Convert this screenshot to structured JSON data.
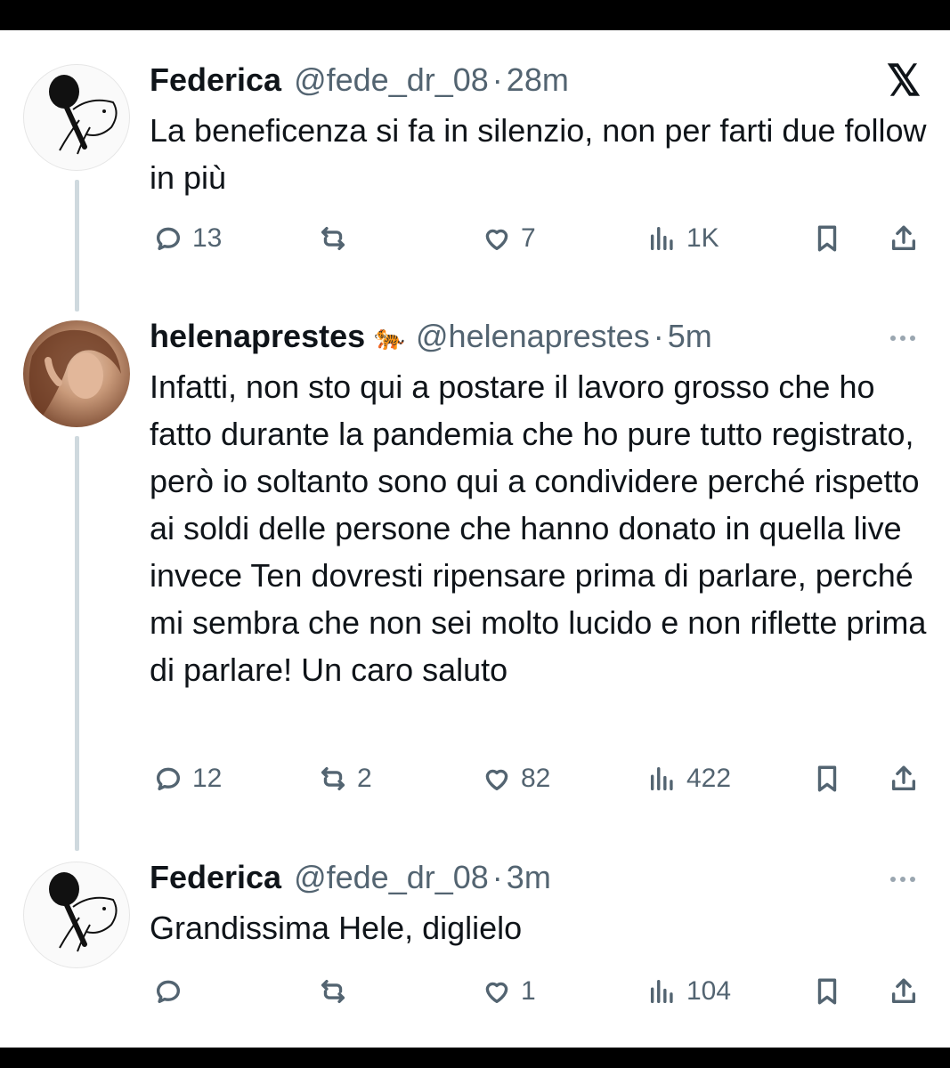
{
  "x_logo": "𝕏",
  "icons": {
    "reply": "reply-icon",
    "repost": "repost-icon",
    "like": "heart-icon",
    "views": "views-icon",
    "bookmark": "bookmark-icon",
    "share": "share-icon",
    "more": "more-icon",
    "logo": "x-logo-icon"
  },
  "colors": {
    "text": "#0f1419",
    "secondary": "#536471",
    "thread_line": "#cfd9de"
  },
  "tweets": [
    {
      "name": "Federica",
      "badge": "",
      "handle": "@fede_dr_08",
      "dot": "·",
      "time": "28m",
      "text": "La beneficenza si fa in silenzio, non per farti due follow in più",
      "replies": "13",
      "reposts": "",
      "likes": "7",
      "views": "1K"
    },
    {
      "name": "helenaprestes",
      "badge": "🐅",
      "handle": "@helenaprestes",
      "dot": "·",
      "time": "5m",
      "text": "Infatti, non sto qui a postare il lavoro grosso che ho fatto durante la pandemia che ho pure tutto registrato, però io soltanto sono qui a condividere perché rispetto ai soldi delle persone che hanno donato in quella live invece Ten dovresti ripensare prima di parlare, perché mi sembra che non sei molto lucido e non riflette prima di parlare! Un caro saluto",
      "replies": "12",
      "reposts": "2",
      "likes": "82",
      "views": "422"
    },
    {
      "name": "Federica",
      "badge": "",
      "handle": "@fede_dr_08",
      "dot": "·",
      "time": "3m",
      "text": "Grandissima Hele, diglielo",
      "replies": "",
      "reposts": "",
      "likes": "1",
      "views": "104"
    }
  ]
}
